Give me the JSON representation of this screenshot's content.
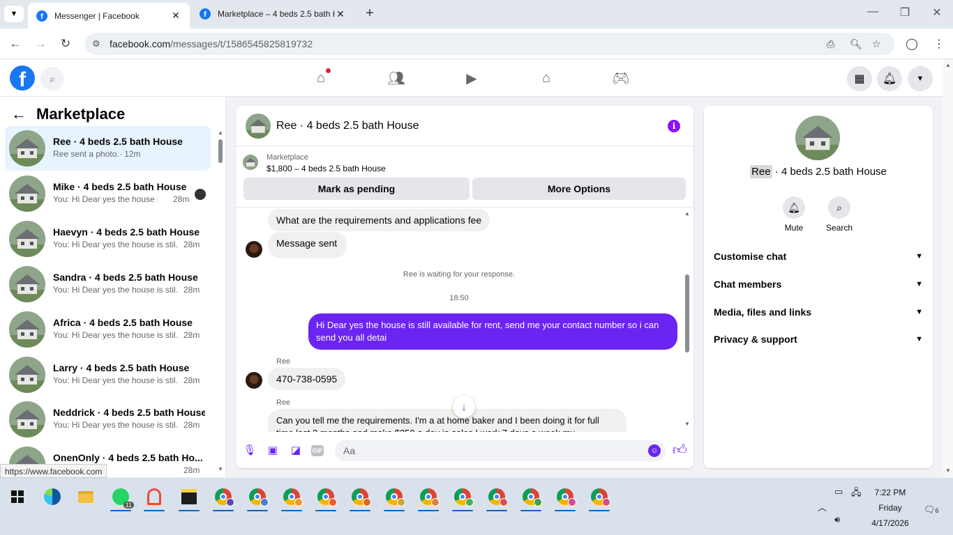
{
  "browser": {
    "tabs": [
      {
        "title": "Messenger | Facebook",
        "active": true
      },
      {
        "title": "Marketplace – 4 beds 2.5 bath H",
        "active": false
      }
    ],
    "url_host": "facebook.com",
    "url_path": "/messages/t/1586545825819732",
    "status_url": "https://www.facebook.com"
  },
  "left_panel": {
    "title": "Marketplace",
    "conversations": [
      {
        "name": "Ree · 4 beds 2.5 bath House",
        "preview": "Ree sent a photo.· 12m",
        "time": "",
        "active": true
      },
      {
        "name": "Mike · 4 beds 2.5 bath House",
        "preview": "You: Hi Dear yes the house is ...",
        "time": "28m"
      },
      {
        "name": "Haevyn · 4 beds 2.5 bath House",
        "preview": "You: Hi Dear yes the house is stil...",
        "time": "28m"
      },
      {
        "name": "Sandra · 4 beds 2.5 bath House",
        "preview": "You: Hi Dear yes the house is stil...",
        "time": "28m"
      },
      {
        "name": "Africa · 4 beds 2.5 bath House",
        "preview": "You: Hi Dear yes the house is stil...",
        "time": "28m"
      },
      {
        "name": "Larry · 4 beds 2.5 bath House",
        "preview": "You: Hi Dear yes the house is stil...",
        "time": "28m"
      },
      {
        "name": "Neddrick · 4 beds 2.5 bath House",
        "preview": "You: Hi Dear yes the house is stil...",
        "time": "28m"
      },
      {
        "name": "OnenOnly · 4 beds 2.5 bath Ho...",
        "preview": "",
        "time": "28m"
      }
    ]
  },
  "chat": {
    "title": "Ree · 4 beds 2.5 bath House",
    "listing_label": "Marketplace",
    "listing_price": "$1,800 – 4 beds 2.5 bath House",
    "buttons": {
      "pending": "Mark as pending",
      "more": "More Options"
    },
    "messages": {
      "m1": "What are the requirements and applications fee",
      "m2": "Message sent",
      "waiting": "Ree is waiting for your response.",
      "time": "18:50",
      "out1": "Hi Dear yes the house is still available for rent, send me your contact number so i can send you all detai",
      "sender1": "Ree",
      "m3": "470-738-0595",
      "sender2": "Ree",
      "m4": "Can you tell me the requirements. I'm a at home baker and I been doing it for full time last 3 months and make $350 a day in sales I work 7 days a week my"
    },
    "input_placeholder": "Aa",
    "accent_color": "#6b24f1"
  },
  "right_panel": {
    "name_first": "Ree",
    "name_rest": " · 4 beds 2.5 bath House",
    "actions": [
      {
        "label": "Mute"
      },
      {
        "label": "Search"
      }
    ],
    "sections": [
      "Customise chat",
      "Chat members",
      "Media, files and links",
      "Privacy & support"
    ]
  },
  "taskbar": {
    "whatsapp_badge": "11",
    "time": "7:22 PM",
    "day": "Friday",
    "date": "4/17/2026",
    "notification_count": "6"
  },
  "colors": {
    "facebook_blue": "#1877f2",
    "messenger_purple": "#6b24f1",
    "active_row": "#e7f3ff"
  }
}
